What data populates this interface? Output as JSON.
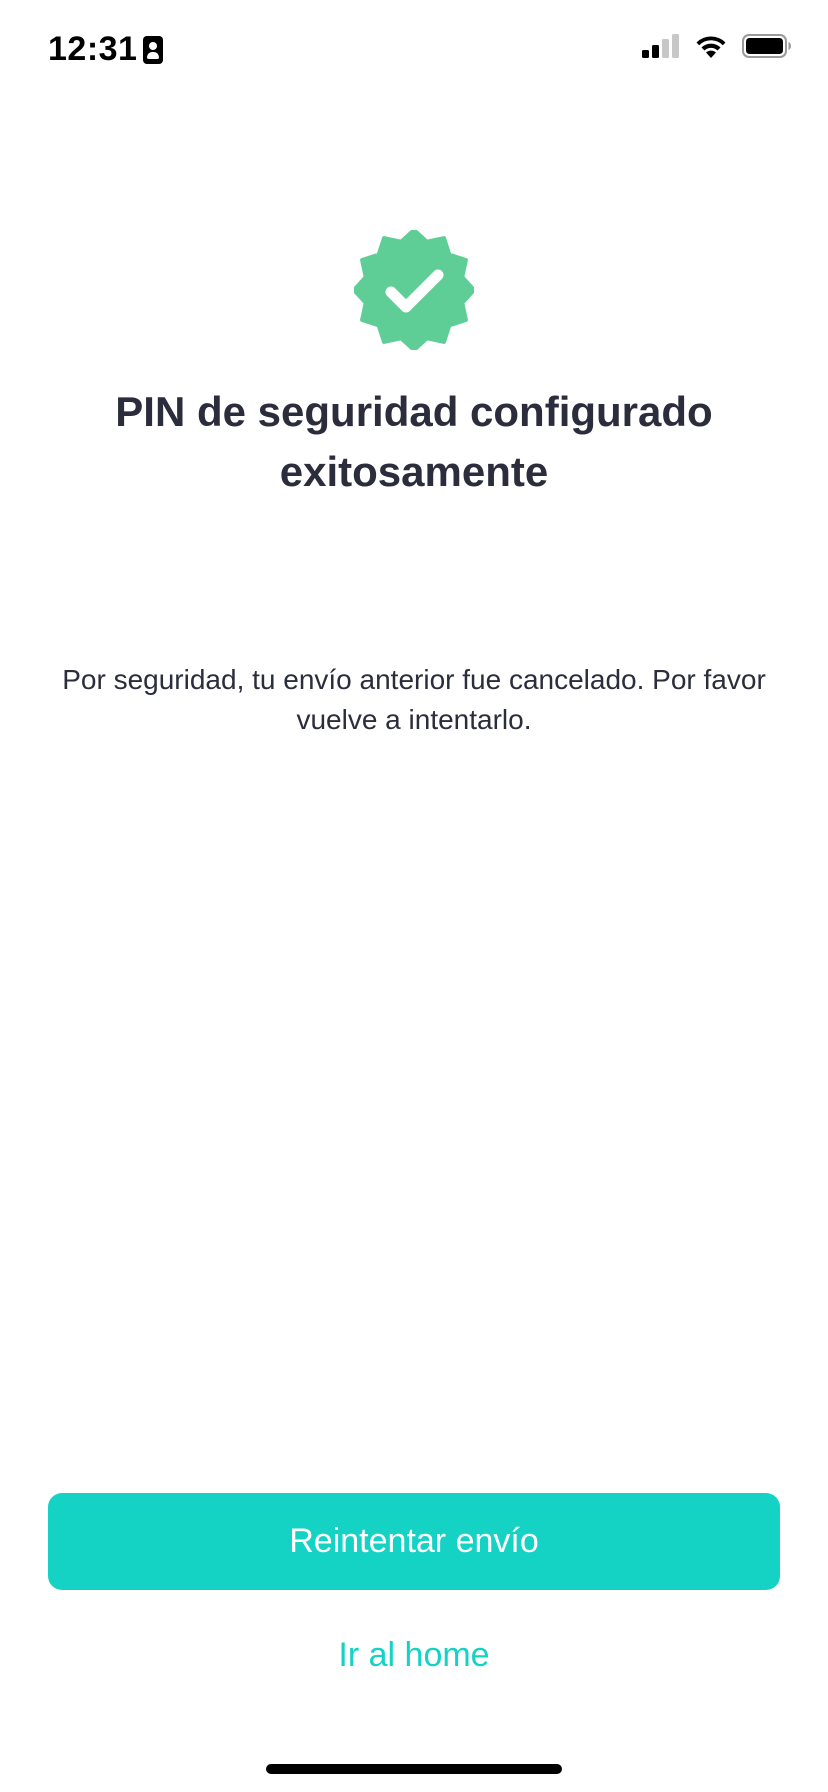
{
  "status_bar": {
    "time": "12:31",
    "contact_icon": "person-badge-icon",
    "signal_icon": "cellular-signal-icon",
    "wifi_icon": "wifi-icon",
    "battery_icon": "battery-icon"
  },
  "success": {
    "icon": "verified-check-badge-icon",
    "badge_color": "#5fce96",
    "title": "PIN de seguridad configurado exitosamente",
    "message": "Por seguridad, tu envío anterior fue cancelado. Por favor vuelve a intentarlo."
  },
  "actions": {
    "retry_label": "Reintentar envío",
    "home_label": "Ir al home",
    "accent_color": "#14d3c4"
  }
}
